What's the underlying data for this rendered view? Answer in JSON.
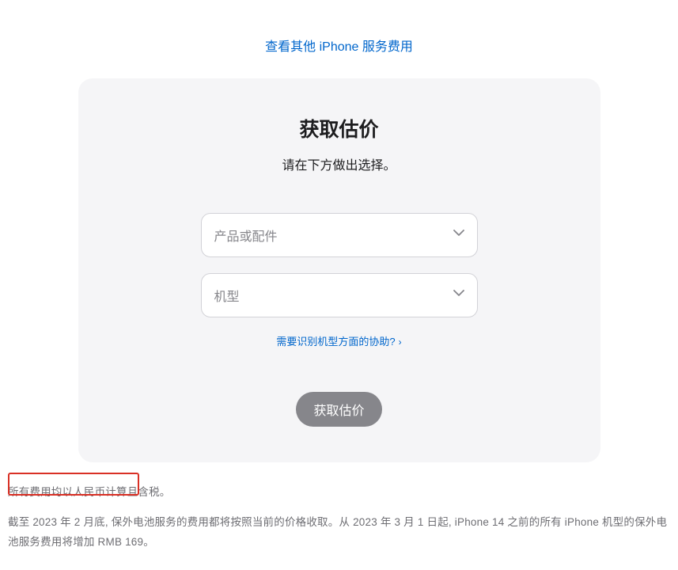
{
  "topLink": "查看其他 iPhone 服务费用",
  "card": {
    "title": "获取估价",
    "subtitle": "请在下方做出选择。",
    "select1": "产品或配件",
    "select2": "机型",
    "helpLink": "需要识别机型方面的协助?",
    "submitLabel": "获取估价"
  },
  "footer": {
    "line1": "所有费用均以人民币计算且含税。",
    "line2": "截至 2023 年 2 月底, 保外电池服务的费用都将按照当前的价格收取。从 2023 年 3 月 1 日起, iPhone 14 之前的所有 iPhone 机型的保外电池服务费用将增加 RMB 169。"
  }
}
